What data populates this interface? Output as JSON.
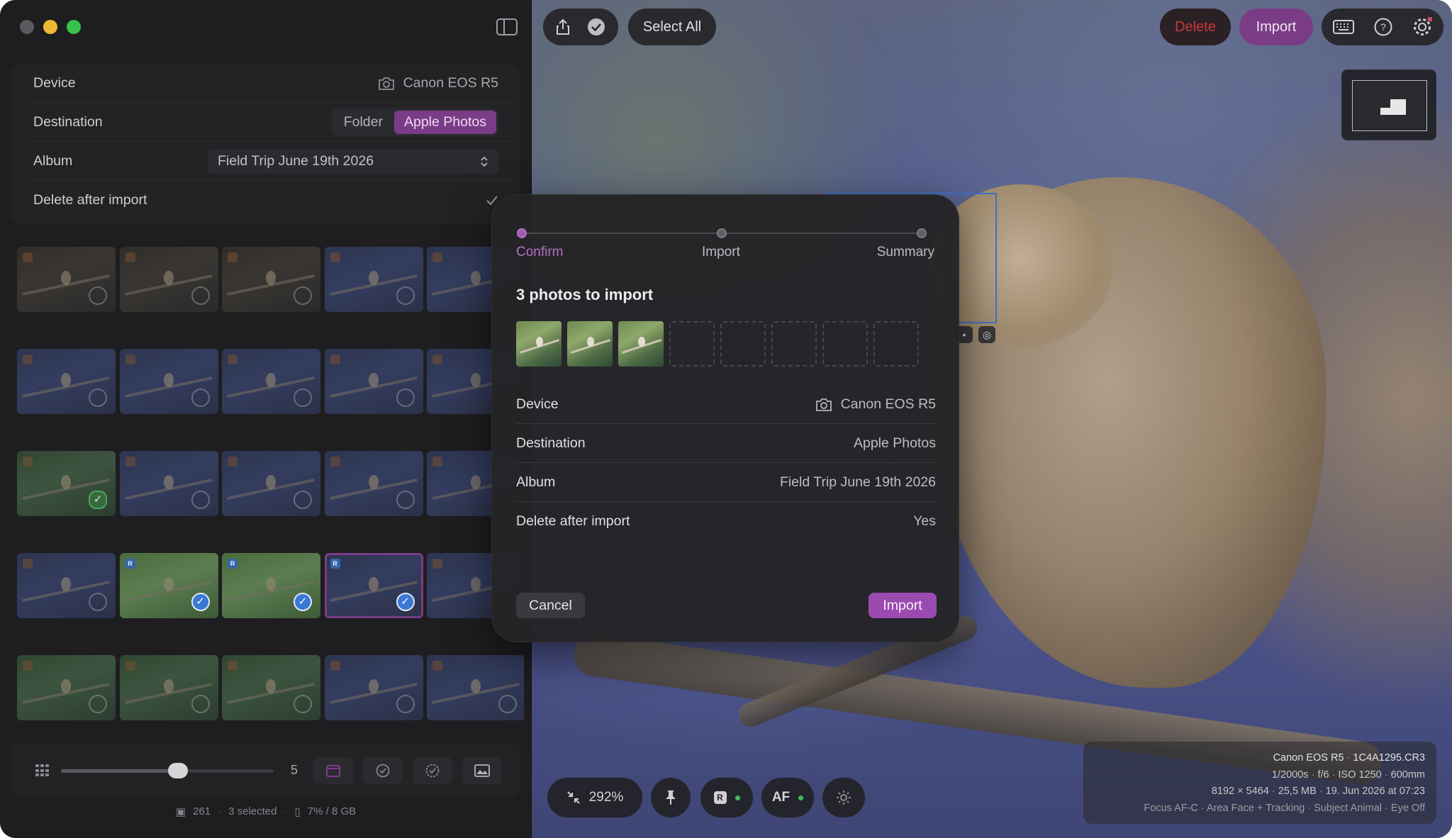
{
  "toolbar": {
    "select_all": "Select All",
    "delete": "Delete",
    "import": "Import",
    "share_icon": "share-icon",
    "check_icon": "checkmark-circle-icon",
    "keyboard_icon": "keyboard-icon",
    "help_icon": "help-icon",
    "settings_icon": "gear-icon"
  },
  "sidebar": {
    "device_label": "Device",
    "device_value": "Canon EOS R5",
    "destination_label": "Destination",
    "destination_options": [
      "Folder",
      "Apple Photos"
    ],
    "destination_selected": "Apple Photos",
    "album_label": "Album",
    "album_value": "Field Trip June 19th 2026",
    "delete_after_label": "Delete after import",
    "delete_after_checked": true,
    "thumb_size_label": "5",
    "thumb_size_level": 0.55,
    "status": {
      "count": "261",
      "selected": "3 selected",
      "storage": "7% / 8 GB"
    }
  },
  "grid": {
    "rows": [
      [
        {
          "t": "dark",
          "tag": "",
          "s": "none"
        },
        {
          "t": "dark",
          "tag": "",
          "s": "none"
        },
        {
          "t": "dark",
          "tag": "",
          "s": "none"
        },
        {
          "t": "blue",
          "tag": "",
          "s": "none"
        },
        {
          "t": "blue",
          "tag": "",
          "s": "none"
        }
      ],
      [
        {
          "t": "blue",
          "tag": "",
          "s": "none"
        },
        {
          "t": "blue",
          "tag": "",
          "s": "none"
        },
        {
          "t": "blue",
          "tag": "",
          "s": "none"
        },
        {
          "t": "blue",
          "tag": "",
          "s": "none"
        },
        {
          "t": "blue",
          "tag": "",
          "s": "none"
        }
      ],
      [
        {
          "t": "green",
          "tag": "",
          "s": "done"
        },
        {
          "t": "blue",
          "tag": "",
          "s": "none"
        },
        {
          "t": "blue",
          "tag": "",
          "s": "none"
        },
        {
          "t": "blue",
          "tag": "",
          "s": "none"
        },
        {
          "t": "blue",
          "tag": "",
          "s": "none"
        }
      ],
      [
        {
          "t": "blue",
          "tag": "",
          "s": "none"
        },
        {
          "t": "bright",
          "tag": "R",
          "s": "sel"
        },
        {
          "t": "bright",
          "tag": "R",
          "s": "sel"
        },
        {
          "t": "blue",
          "tag": "R",
          "s": "sel",
          "active": true
        },
        {
          "t": "blue",
          "tag": "",
          "s": "none"
        }
      ],
      [
        {
          "t": "green",
          "tag": "",
          "s": "none"
        },
        {
          "t": "green",
          "tag": "",
          "s": "none"
        },
        {
          "t": "green",
          "tag": "",
          "s": "none"
        },
        {
          "t": "blue",
          "tag": "",
          "s": "none"
        },
        {
          "t": "blue",
          "tag": "",
          "s": "none"
        }
      ]
    ]
  },
  "viewer": {
    "zoom": "292%",
    "raw_label": "R",
    "af_label": "AF",
    "exif": {
      "camera": "Canon EOS R5",
      "file": "1C4A1295.CR3",
      "shutter": "1/2000s",
      "aperture": "f/6",
      "iso": "ISO 1250",
      "focal": "600mm",
      "dimensions": "8192 × 5464",
      "size": "25,5 MB",
      "date": "19. Jun 2026 at 07:23",
      "focus_mode": "Focus AF-C",
      "area": "Area Face + Tracking",
      "subject": "Subject Animal",
      "eye": "Eye Off"
    }
  },
  "modal": {
    "steps": [
      "Confirm",
      "Import",
      "Summary"
    ],
    "active_step": 0,
    "title": "3 photos to import",
    "device_label": "Device",
    "device_value": "Canon EOS R5",
    "destination_label": "Destination",
    "destination_value": "Apple Photos",
    "album_label": "Album",
    "album_value": "Field Trip June 19th 2026",
    "delete_label": "Delete after import",
    "delete_value": "Yes",
    "cancel": "Cancel",
    "import": "Import",
    "photo_count": 3,
    "slot_count": 8
  },
  "colors": {
    "accent": "#7a3c86",
    "accent_bright": "#9b4ab0",
    "delete": "#c9373d",
    "selection": "#3a78d6"
  }
}
